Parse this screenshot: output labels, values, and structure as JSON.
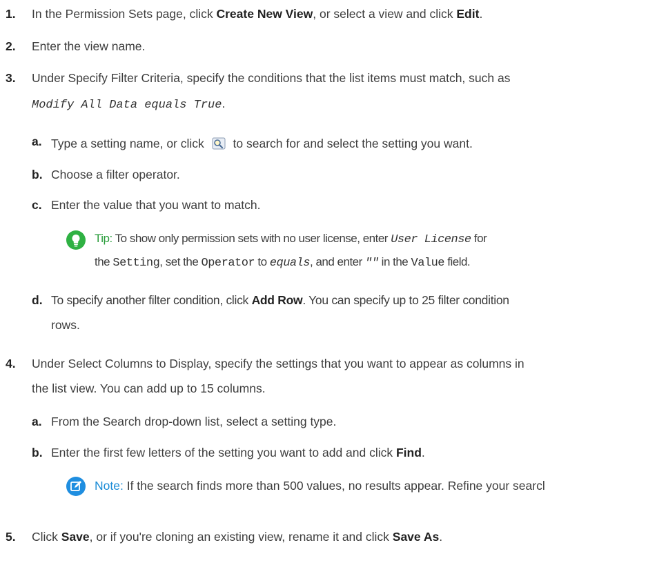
{
  "steps": {
    "s1": {
      "num": "1.",
      "pre": "In the Permission Sets page, click ",
      "b1": "Create New View",
      "mid": ", or select a view and click ",
      "b2": "Edit",
      "post": "."
    },
    "s2": {
      "num": "2.",
      "text": "Enter the view name."
    },
    "s3": {
      "num": "3.",
      "line1": "Under Specify Filter Criteria, specify the conditions that the list items must match, such as",
      "code": "Modify All Data equals True",
      "post": "."
    },
    "s3a": {
      "num": "a.",
      "pre": "Type a setting name, or click",
      "post": "to search for and select the setting you want."
    },
    "s3b": {
      "num": "b.",
      "text": "Choose a filter operator."
    },
    "s3c": {
      "num": "c.",
      "text": "Enter the value that you want to match."
    },
    "tip": {
      "label": "Tip:",
      "l1_pre": "To show only permission sets with no user license, enter",
      "l1_code": "User License",
      "l1_post": "for",
      "l2_a": "the",
      "l2_code1": "Setting",
      "l2_b": ", set the",
      "l2_code2": "Operator",
      "l2_c": "to",
      "l2_code3": "equals",
      "l2_d": ", and enter",
      "l2_code4": "\"\"",
      "l2_e": "in the",
      "l2_code5": "Value",
      "l2_f": "field."
    },
    "s3d": {
      "num": "d.",
      "pre": "To specify another filter condition, click ",
      "b": "Add Row",
      "post": ". You can specify up to 25 filter condition",
      "line2": "rows."
    },
    "s4": {
      "num": "4.",
      "line1": "Under Select Columns to Display, specify the settings that you want to appear as columns in",
      "line2": "the list view. You can add up to 15 columns."
    },
    "s4a": {
      "num": "a.",
      "text": "From the Search drop-down list, select a setting type."
    },
    "s4b": {
      "num": "b.",
      "pre": "Enter the first few letters of the setting you want to add and click ",
      "b": "Find",
      "post": "."
    },
    "note": {
      "label": "Note:",
      "text": "If the search finds more than 500 values, no results appear. Refine your searcl"
    },
    "s5": {
      "num": "5.",
      "pre": "Click ",
      "b1": "Save",
      "mid": ", or if you're cloning an existing view, rename it and click ",
      "b2": "Save As",
      "post": "."
    }
  },
  "icons": {
    "tip": "lightbulb-icon",
    "note": "edit-note-icon",
    "lookup": "lookup-search-icon"
  },
  "colors": {
    "tip": "#2a9d3c",
    "note": "#1a8bd6",
    "text": "#3d3d3d"
  }
}
